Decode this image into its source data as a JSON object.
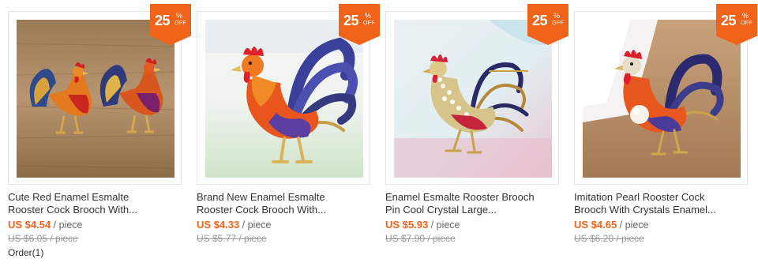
{
  "products": [
    {
      "badge": {
        "percent": "25",
        "pct_sign": "%",
        "off": "OFF"
      },
      "title_line1": "Cute Red Enamel Esmalte",
      "title_line2": "Rooster Cock Brooch With...",
      "price_now": "US $4.54",
      "unit": " / piece",
      "price_orig": "US $6.05 / piece",
      "orders": "Order(1)",
      "image": {
        "subject": "two enamel rooster brooches",
        "background": "wood"
      }
    },
    {
      "badge": {
        "percent": "25",
        "pct_sign": "%",
        "off": "OFF"
      },
      "title_line1": "Brand New Enamel Esmalte",
      "title_line2": "Rooster Cock Brooch With...",
      "price_now": "US $4.33",
      "unit": " / piece",
      "price_orig": "US $5.77 / piece",
      "image": {
        "subject": "blue and orange enamel rooster brooch",
        "background": "white and light green"
      }
    },
    {
      "badge": {
        "percent": "25",
        "pct_sign": "%",
        "off": "OFF"
      },
      "title_line1": "Enamel Esmalte Rooster Brooch",
      "title_line2": "Pin Cool Crystal Large...",
      "price_now": "US $5.93",
      "unit": " / piece",
      "price_orig": "US $7.90 / piece",
      "image": {
        "subject": "crystal rooster brooch",
        "background": "pink and light blue"
      }
    },
    {
      "badge": {
        "percent": "25",
        "pct_sign": "%",
        "off": "OFF"
      },
      "title_line1": "Imitation Pearl Rooster Cock",
      "title_line2": "Brooch With Crystals Enamel...",
      "price_now": "US $4.65",
      "unit": " / piece",
      "price_orig": "US $6.20 / piece",
      "image": {
        "subject": "rooster brooch with pearl",
        "background": "white cup on wood"
      }
    }
  ],
  "colors": {
    "accent": "#f2631a",
    "text": "#333333",
    "muted": "#999999",
    "border": "#e6e6e6"
  }
}
